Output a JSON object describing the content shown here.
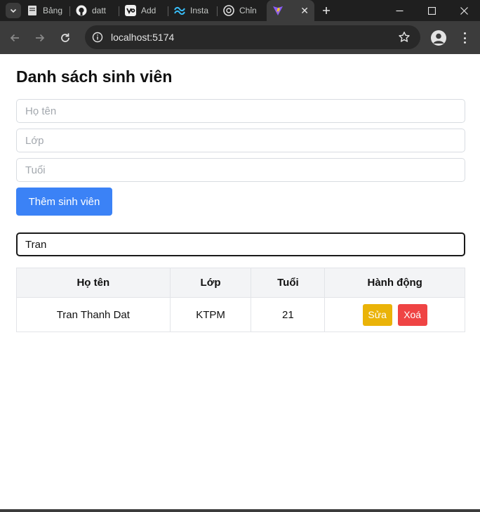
{
  "browser": {
    "tabs": [
      {
        "label": "Bảng",
        "icon": "document-icon"
      },
      {
        "label": "datt",
        "icon": "github-icon"
      },
      {
        "label": "Add",
        "icon": "vercel-icon"
      },
      {
        "label": "Insta",
        "icon": "tailwind-icon"
      },
      {
        "label": "Chỉn",
        "icon": "chatgpt-icon"
      },
      {
        "label": "",
        "icon": "vite-icon",
        "active": true
      }
    ],
    "url": "localhost:5174"
  },
  "page": {
    "title": "Danh sách sinh viên",
    "form": {
      "name_placeholder": "Họ tên",
      "class_placeholder": "Lớp",
      "age_placeholder": "Tuổi",
      "add_button": "Thêm sinh viên"
    },
    "search": {
      "value": "Tran"
    },
    "table": {
      "headers": [
        "Họ tên",
        "Lớp",
        "Tuổi",
        "Hành động"
      ],
      "rows": [
        {
          "name": "Tran Thanh Dat",
          "class": "KTPM",
          "age": "21",
          "edit_label": "Sửa",
          "delete_label": "Xoá"
        }
      ]
    }
  },
  "colors": {
    "primary": "#3b82f6",
    "edit": "#eab308",
    "delete": "#ef4444",
    "header_bg": "#f3f4f6"
  }
}
